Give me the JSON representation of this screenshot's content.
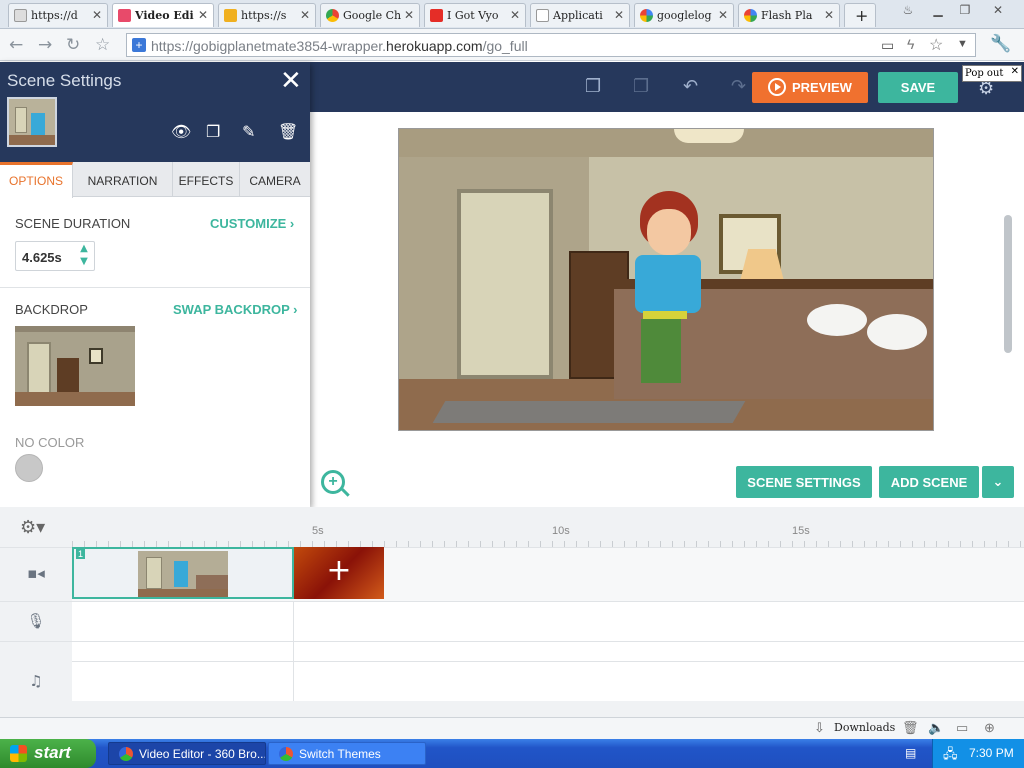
{
  "browser": {
    "tabs": [
      {
        "label": "https://d",
        "color": "#cccccc"
      },
      {
        "label": "Video Edi",
        "color": "#e84a6a",
        "active": true
      },
      {
        "label": "https://s",
        "color": "#f0b020"
      },
      {
        "label": "Google Ch",
        "color": "#4caf50"
      },
      {
        "label": "I Got Vyo",
        "color": "#e52d27"
      },
      {
        "label": "Applicati",
        "color": "#cccccc"
      },
      {
        "label": "googlelog",
        "color": "#4285f4"
      },
      {
        "label": "Flash Pla",
        "color": "#4285f4"
      }
    ],
    "new_tab": "+",
    "url_host": "https://gobigplanetmate3854-wrapper.",
    "url_domain": "herokuapp.com",
    "url_path": "/go_full"
  },
  "header": {
    "preview_label": "PREVIEW",
    "save_label": "SAVE",
    "popout_label": "Pop out"
  },
  "panel": {
    "title": "Scene Settings",
    "close": "✕",
    "tabs": [
      "OPTIONS",
      "NARRATION",
      "EFFECTS",
      "CAMERA"
    ],
    "scene_duration_label": "SCENE DURATION",
    "customize_link": "CUSTOMIZE ›",
    "duration_value": "4.625s",
    "backdrop_label": "BACKDROP",
    "swap_backdrop_link": "SWAP BACKDROP ›",
    "no_color_label": "NO COLOR"
  },
  "stage": {
    "scene_settings_button": "SCENE SETTINGS",
    "add_scene_button": "ADD SCENE"
  },
  "timeline": {
    "ruler_ticks": [
      "5s",
      "10s",
      "15s"
    ],
    "scene_number": "1",
    "add_clip": "+"
  },
  "status": {
    "downloads_label": "Downloads"
  },
  "taskbar": {
    "start_label": "start",
    "tasks": [
      "Video Editor - 360 Bro...",
      "Switch Themes"
    ],
    "clock": "7:30 PM"
  },
  "colors": {
    "accent_teal": "#3db69e",
    "accent_orange": "#f0712f",
    "header_navy": "#26385c"
  }
}
